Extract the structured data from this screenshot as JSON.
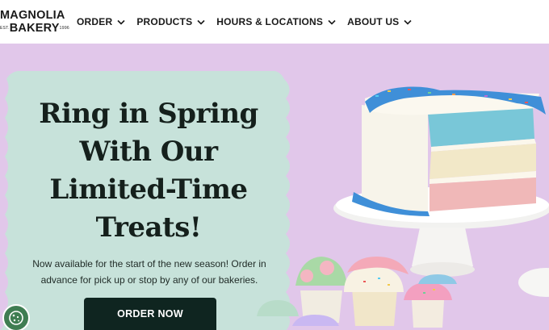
{
  "brand": {
    "name_line1": "MAGNOLIA",
    "name_line2": "BAKERY",
    "est": "EST.",
    "year": "1996"
  },
  "nav": {
    "items": [
      {
        "label": "ORDER"
      },
      {
        "label": "PRODUCTS"
      },
      {
        "label": "HOURS & LOCATIONS"
      },
      {
        "label": "ABOUT US"
      }
    ]
  },
  "hero": {
    "headline": "Ring in Spring With Our Limited-Time Treats!",
    "subtext": "Now available for the start of the new season! Order in advance for pick up or stop by any of our bakeries.",
    "cta_label": "ORDER NOW"
  },
  "colors": {
    "hero_background": "#e1c7ea",
    "panel_background": "#c7e2da",
    "cta_background": "#0f2520",
    "cookie_button": "#3f7d52"
  },
  "icons": {
    "nav_chevron": "chevron-down-icon",
    "cookie_settings": "cookie-icon"
  },
  "images": {
    "hero_cake": "layered-cake-photo",
    "hero_cupcakes": "cupcakes-photo"
  }
}
